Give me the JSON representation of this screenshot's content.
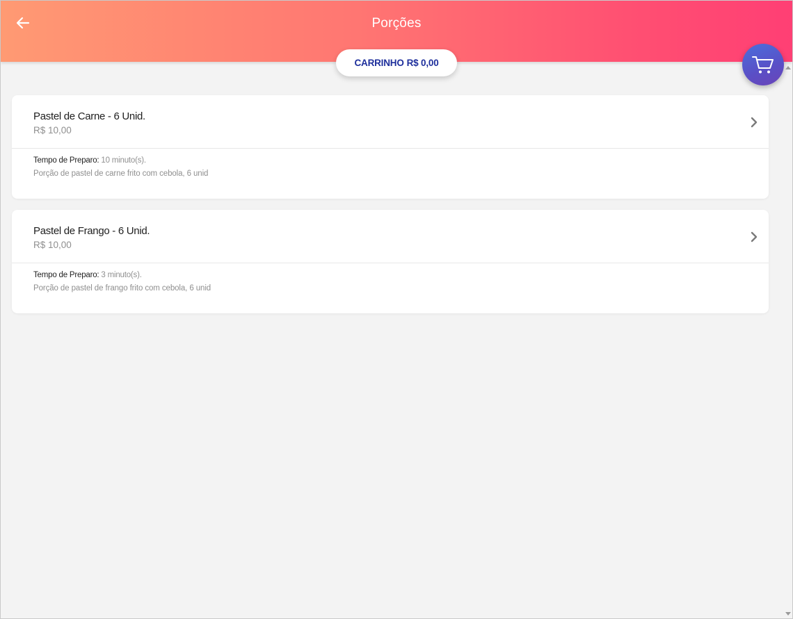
{
  "header": {
    "title": "Porções",
    "back_icon": "arrow-left-icon",
    "gradient_start": "#ff9a73",
    "gradient_end": "#ff3f74"
  },
  "cart": {
    "label": "CARRINHO",
    "total": "R$ 0,00",
    "label_color": "#1e2f9c",
    "fab_icon": "shopping-cart-icon"
  },
  "items": [
    {
      "name": "Pastel de Carne - 6 Unid.",
      "price": "R$ 10,00",
      "prep_label": "Tempo de Preparo:",
      "prep_value": "10 minuto(s).",
      "description": "Porção de pastel de carne frito com cebola, 6 unid"
    },
    {
      "name": "Pastel de Frango - 6 Unid.",
      "price": "R$ 10,00",
      "prep_label": "Tempo de Preparo:",
      "prep_value": "3 minuto(s).",
      "description": "Porção de pastel de frango frito com cebola, 6 unid"
    }
  ]
}
